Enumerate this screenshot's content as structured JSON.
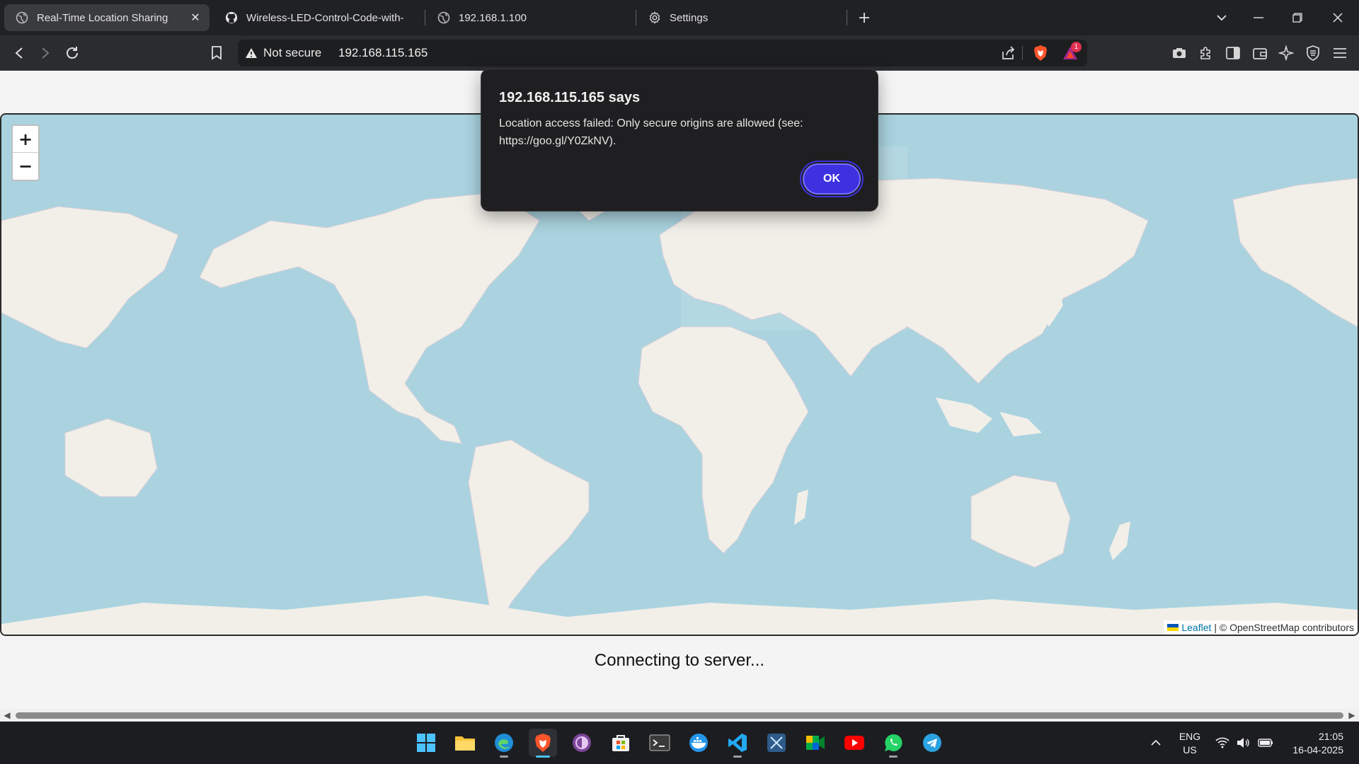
{
  "browser": {
    "tabs": [
      {
        "title": "Real-Time Location Sharing",
        "icon": "globe-icon",
        "active": true
      },
      {
        "title": "Wireless-LED-Control-Code-with-N",
        "icon": "github-icon",
        "active": false
      },
      {
        "title": "192.168.1.100",
        "icon": "globe-icon",
        "active": false
      },
      {
        "title": "Settings",
        "icon": "gear-icon",
        "active": false
      }
    ],
    "security_label": "Not secure",
    "url": "192.168.115.165",
    "notification_count": "1"
  },
  "dialog": {
    "title": "192.168.115.165 says",
    "message": "Location access failed: Only secure origins are allowed (see: https://goo.gl/Y0ZkNV).",
    "ok_label": "OK"
  },
  "map": {
    "zoom_in": "+",
    "zoom_out": "−",
    "attribution_link": "Leaflet",
    "attribution_text": "| © OpenStreetMap contributors",
    "colors": {
      "water": "#aad3df",
      "land": "#f2efe9",
      "border": "#c9b9c9"
    }
  },
  "status_text": "Connecting to server...",
  "taskbar": {
    "apps": [
      "windows-start-icon",
      "file-explorer-icon",
      "edge-icon",
      "brave-icon",
      "tor-icon",
      "store-icon",
      "terminal-icon",
      "docker-icon",
      "vscode-icon",
      "snipping-icon",
      "meet-icon",
      "youtube-icon",
      "whatsapp-icon",
      "telegram-icon"
    ],
    "language_line1": "ENG",
    "language_line2": "US",
    "time": "21:05",
    "date": "16-04-2025"
  }
}
